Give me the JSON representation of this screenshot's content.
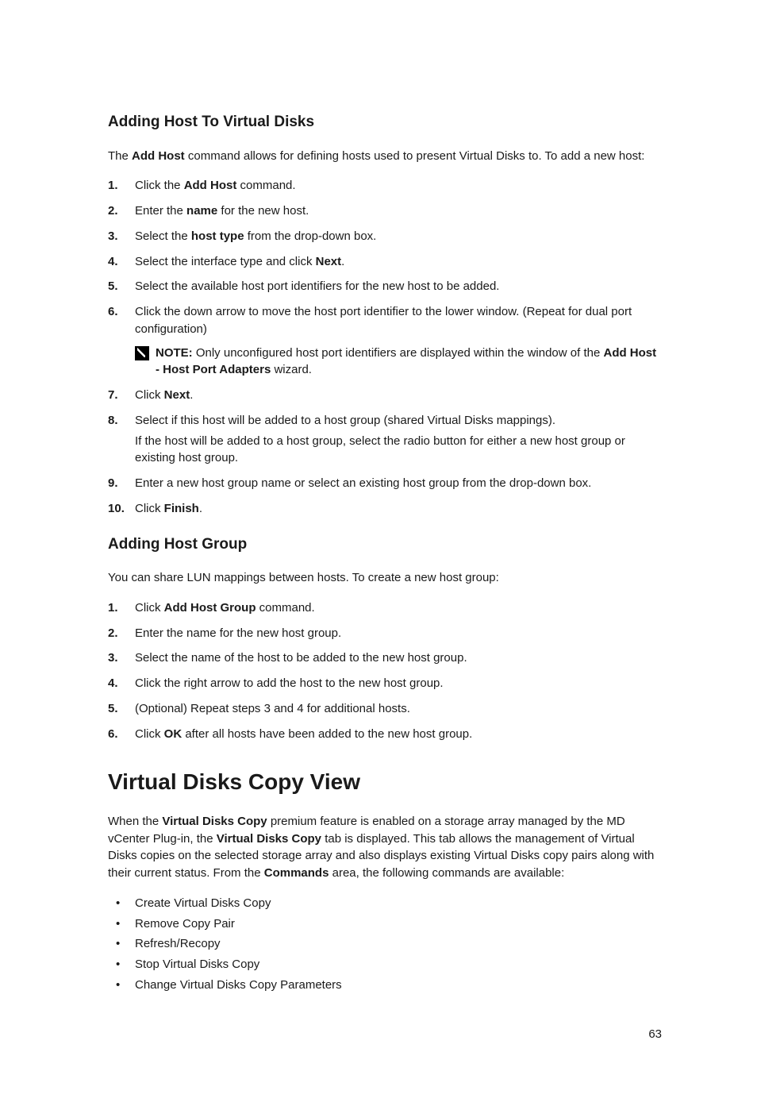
{
  "section1": {
    "title": "Adding Host To Virtual Disks",
    "intro_pre": "The ",
    "intro_b1": "Add Host",
    "intro_post": " command allows for defining hosts used to present Virtual Disks to. To add a new host:",
    "steps": {
      "s1_a": "Click the ",
      "s1_b": "Add Host",
      "s1_c": " command.",
      "s2_a": "Enter the ",
      "s2_b": "name",
      "s2_c": " for the new host.",
      "s3_a": "Select the ",
      "s3_b": "host type",
      "s3_c": " from the drop-down box.",
      "s4_a": "Select the interface type and click ",
      "s4_b": "Next",
      "s4_c": ".",
      "s5": "Select the available host port identifiers for the new host to be added.",
      "s6": "Click the down arrow to move the host port identifier to the lower window. (Repeat for dual port configuration)",
      "s6_note_label": "NOTE: ",
      "s6_note_a": "Only unconfigured host port identifiers are displayed within the window of the ",
      "s6_note_b": "Add Host - Host Port Adapters",
      "s6_note_c": " wizard.",
      "s7_a": "Click ",
      "s7_b": "Next",
      "s7_c": ".",
      "s8_a": "Select if this host will be added to a host group (shared Virtual Disks mappings).",
      "s8_sub": "If the host will be added to a host group, select the radio button for either a new host group or existing host group.",
      "s9": "Enter a new host group name or select an existing host group from the drop-down box.",
      "s10_a": "Click ",
      "s10_b": "Finish",
      "s10_c": "."
    }
  },
  "section2": {
    "title": "Adding Host Group",
    "intro": "You can share LUN mappings between hosts. To create a new host group:",
    "steps": {
      "s1_a": "Click ",
      "s1_b": "Add Host Group",
      "s1_c": " command.",
      "s2": "Enter the name for the new host group.",
      "s3": "Select the name of the host to be added to the new host group.",
      "s4": "Click the right arrow to add the host to the new host group.",
      "s5": "(Optional) Repeat steps 3 and 4 for additional hosts.",
      "s6_a": "Click ",
      "s6_b": "OK",
      "s6_c": " after all hosts have been added to the new host group."
    }
  },
  "section3": {
    "title": "Virtual Disks Copy View",
    "p_a": "When the ",
    "p_b1": "Virtual Disks Copy",
    "p_c": " premium feature is enabled on a storage array managed by the MD vCenter Plug-in, the ",
    "p_b2": "Virtual Disks Copy",
    "p_d": " tab is displayed. This tab allows the management of Virtual Disks copies on the selected storage array and also displays existing Virtual Disks copy pairs along with their current status. From the ",
    "p_b3": "Commands",
    "p_e": " area, the following commands are available:",
    "bullets": [
      "Create Virtual Disks Copy",
      "Remove Copy Pair",
      "Refresh/Recopy",
      "Stop Virtual Disks Copy",
      "Change Virtual Disks Copy Parameters"
    ]
  },
  "page_number": "63"
}
